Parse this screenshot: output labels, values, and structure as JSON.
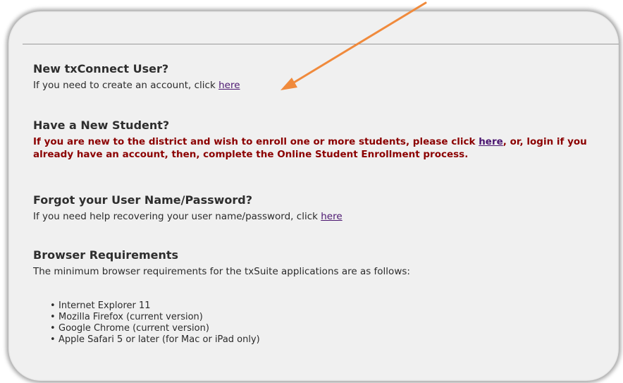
{
  "new_user": {
    "heading": "New txConnect User?",
    "text": "If you need to create an account, click ",
    "link": "here"
  },
  "new_student": {
    "heading": "Have a New Student?",
    "text_before": "If you are new to the district and wish to enroll one or more students, please click ",
    "link": "here",
    "text_after": ", or, login if you already have an account, then, complete the Online Student Enrollment process."
  },
  "forgot": {
    "heading": "Forgot your User Name/Password?",
    "text": "If you need help recovering your user name/password, click ",
    "link": "here"
  },
  "browser": {
    "heading": "Browser Requirements",
    "text": "The minimum browser requirements for the txSuite applications are as follows:",
    "items": [
      "Internet Explorer 11",
      "Mozilla Firefox (current version)",
      "Google Chrome (current version)",
      "Apple Safari 5 or later (for Mac or iPad only)"
    ]
  },
  "colors": {
    "panel_bg": "#f0f0f0",
    "link": "#4b1670",
    "alert_text": "#8b0000",
    "arrow": "#f08a3c"
  }
}
